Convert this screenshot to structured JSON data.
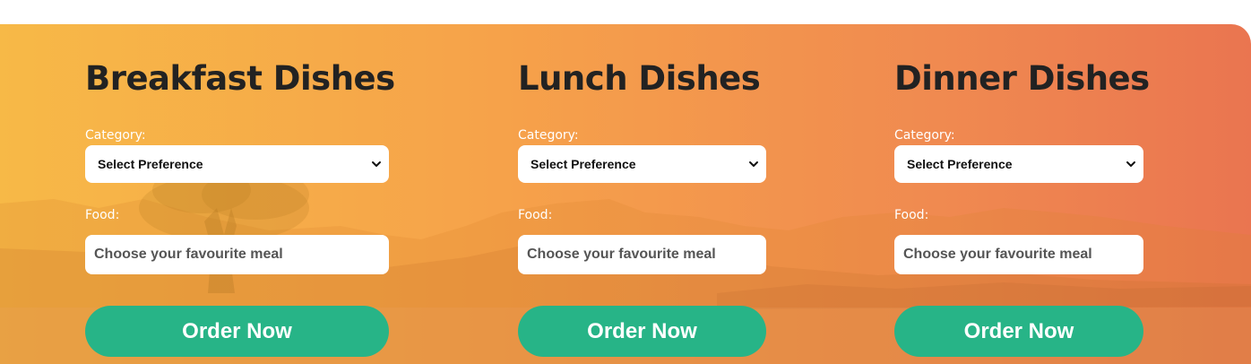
{
  "columns": [
    {
      "title": "Breakfast Dishes",
      "category_label": "Category:",
      "category_value": "Select Preference",
      "food_label": "Food:",
      "food_placeholder": "Choose your favourite meal",
      "button_label": "Order Now"
    },
    {
      "title": "Lunch Dishes",
      "category_label": "Category:",
      "category_value": "Select Preference",
      "food_label": "Food:",
      "food_placeholder": "Choose your favourite meal",
      "button_label": "Order Now"
    },
    {
      "title": "Dinner Dishes",
      "category_label": "Category:",
      "category_value": "Select Preference",
      "food_label": "Food:",
      "food_placeholder": "Choose your favourite meal",
      "button_label": "Order Now"
    }
  ],
  "icons": {
    "select": "chevron-down-icon"
  },
  "colors": {
    "heading": "#222222",
    "label": "#ffffff",
    "button": "#27b487",
    "button_text": "#ffffff",
    "gradient_left": "#f7b947",
    "gradient_right": "#ea7550"
  }
}
